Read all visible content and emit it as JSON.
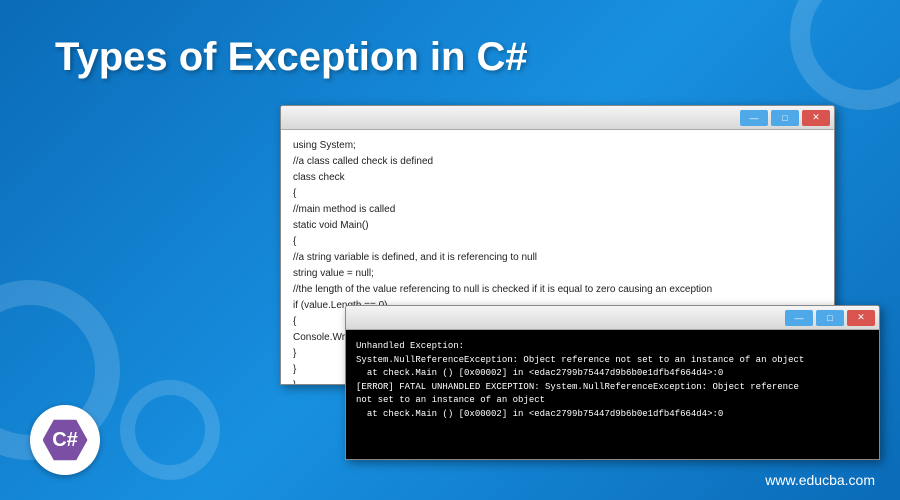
{
  "title": "Types of Exception in C#",
  "code_window": {
    "code": "using System;\n//a class called check is defined\nclass check\n{\n//main method is called\nstatic void Main()\n{\n//a string variable is defined, and it is referencing to null\nstring value = null;\n//the length of the value referencing to null is checked if it is equal to zero causing an exception\nif (value.Length == 0)\n{\nConsole.WriteLin\n}\n}\n}"
  },
  "console_window": {
    "output": "Unhandled Exception:\nSystem.NullReferenceException: Object reference not set to an instance of an object\n  at check.Main () [0x00002] in <edac2799b75447d9b6b0e1dfb4f664d4>:0\n[ERROR] FATAL UNHANDLED EXCEPTION: System.NullReferenceException: Object reference\nnot set to an instance of an object\n  at check.Main () [0x00002] in <edac2799b75447d9b6b0e1dfb4f664d4>:0"
  },
  "buttons": {
    "min": "—",
    "max": "□",
    "close": "✕"
  },
  "logo_text": "C#",
  "site_url": "www.educba.com"
}
